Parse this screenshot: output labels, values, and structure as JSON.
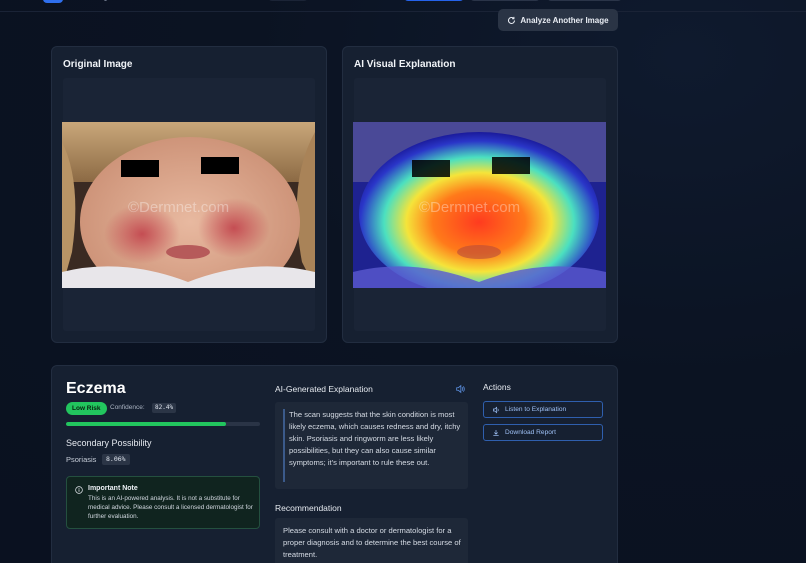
{
  "actions_top": {
    "analyze_another_label": "Analyze Another Image"
  },
  "images": {
    "original_title": "Original Image",
    "ai_title": "AI Visual Explanation"
  },
  "result": {
    "diagnosis": "Eczema",
    "risk_label": "Low Risk",
    "confidence_label": "Confidence:",
    "confidence_value": "82.4%",
    "confidence_fraction": 0.824,
    "secondary_title": "Secondary Possibility",
    "secondary_name": "Psoriasis",
    "secondary_value": "8.06%",
    "note_title": "Important Note",
    "note_body": "This is an AI-powered analysis. It is not a substitute for medical advice. Please consult a licensed dermatologist for further evaluation."
  },
  "explanation": {
    "title": "AI-Generated Explanation",
    "text": "The scan suggests that the skin condition is most likely eczema, which causes redness and dry, itchy skin. Psoriasis and ringworm are less likely possibilities, but they can also cause similar symptoms; it's important to rule these out."
  },
  "recommendation": {
    "title": "Recommendation",
    "text": "Please consult with a doctor or dermatologist for a proper diagnosis and to determine the best course of treatment."
  },
  "actions": {
    "title": "Actions",
    "listen_label": "Listen to Explanation",
    "download_label": "Download Report"
  },
  "watermark": "©Dermnet.com",
  "colors": {
    "accent": "#2563eb",
    "success": "#22c55e",
    "card": "#162031"
  }
}
